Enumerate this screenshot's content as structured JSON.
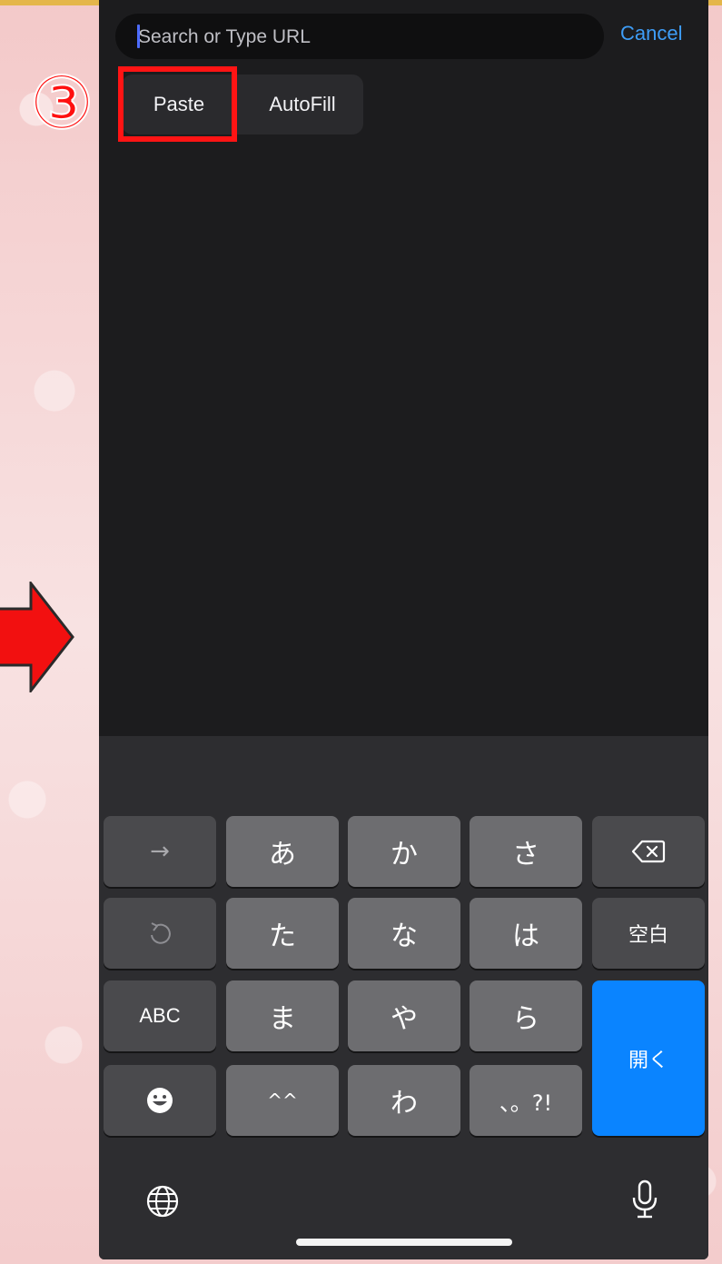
{
  "search": {
    "placeholder": "Search or Type URL",
    "cancel_label": "Cancel"
  },
  "edit_menu": {
    "paste_label": "Paste",
    "autofill_label": "AutoFill"
  },
  "annotation": {
    "step_number": "③",
    "highlight_color": "#ff1414"
  },
  "keyboard": {
    "row1": {
      "arrow_key": "→",
      "k1": "あ",
      "k2": "か",
      "k3": "さ",
      "delete_icon": "delete-icon"
    },
    "row2": {
      "undo_icon": "undo-icon",
      "k1": "た",
      "k2": "な",
      "k3": "は",
      "space_label": "空白"
    },
    "row3": {
      "abc_label": "ABC",
      "k1": "ま",
      "k2": "や",
      "k3": "ら"
    },
    "row4": {
      "emoji_icon": "emoji-icon",
      "k1": "^^",
      "k2": "わ",
      "k3": "、。?!"
    },
    "return_label": "開く",
    "globe_icon": "globe-icon",
    "mic_icon": "microphone-icon"
  },
  "colors": {
    "accent": "#0a84ff",
    "link": "#3e9df7",
    "annotation_red": "#ff1414"
  }
}
